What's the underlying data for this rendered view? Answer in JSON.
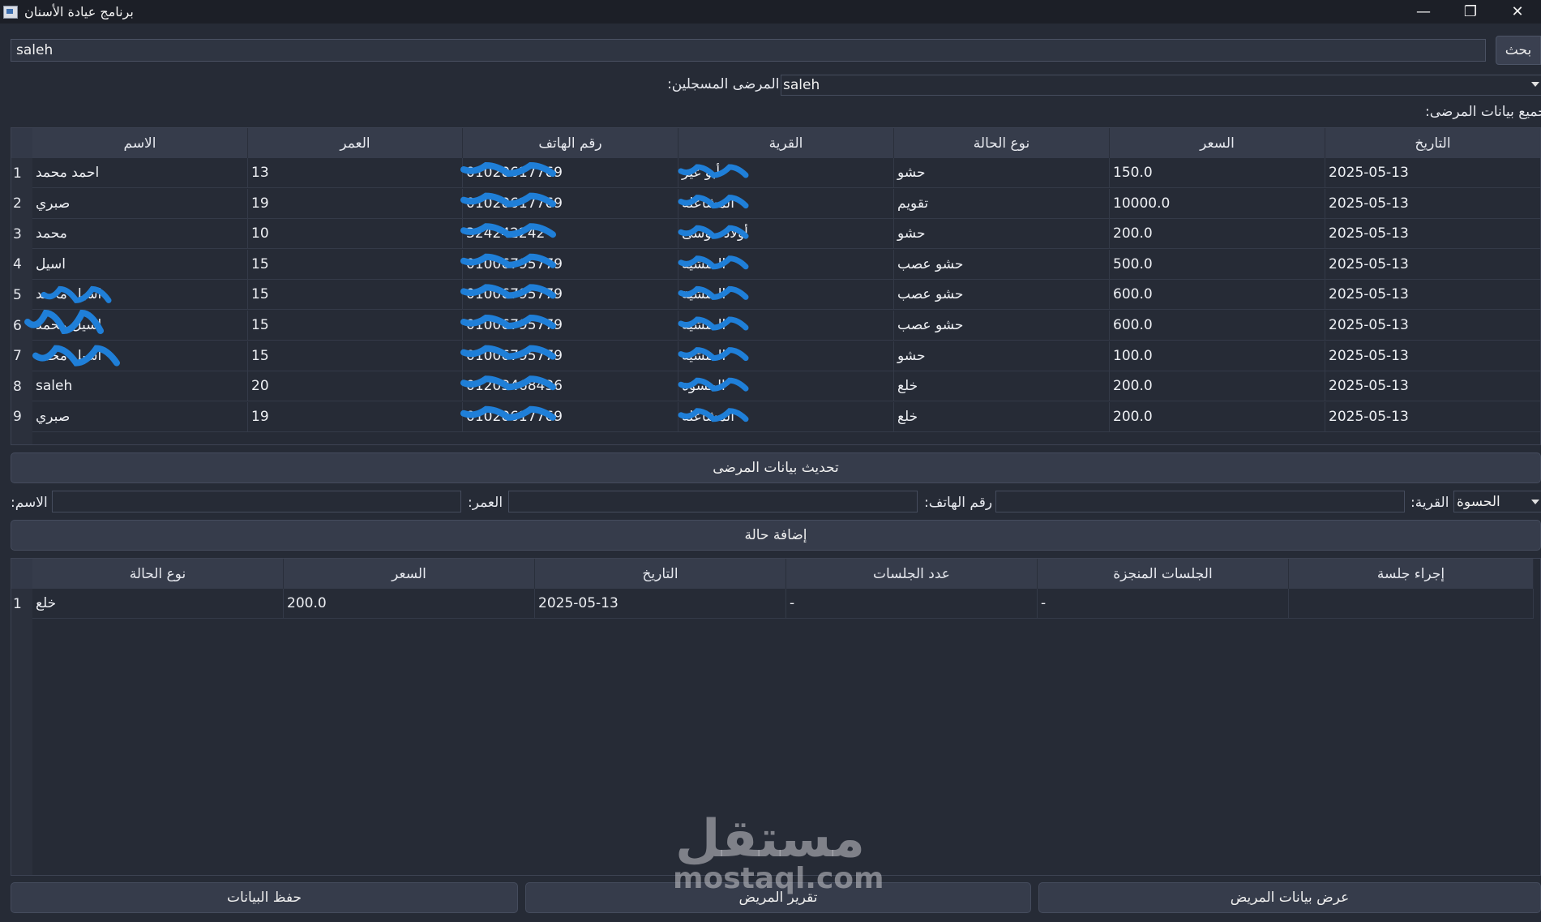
{
  "window": {
    "title": "برنامج عيادة الأسنان",
    "controls": [
      "—",
      "❐",
      "✕"
    ]
  },
  "search": {
    "value": "saleh",
    "button_label": "بحث"
  },
  "registered_patients": {
    "label": "المرضى المسجلين:",
    "selected": "saleh"
  },
  "all_patients_label": "جميع بيانات المرضى:",
  "patients_table": {
    "columns": [
      "الاسم",
      "العمر",
      "رقم الهاتف",
      "القرية",
      "نوع الحالة",
      "السعر",
      "التاريخ"
    ],
    "rows": [
      [
        "احمد محمد",
        "13",
        "01020617769",
        "أبو غير",
        "حشو",
        "150.0",
        "2025-05-13"
      ],
      [
        "صبري",
        "19",
        "01020617769",
        "المشاعلة",
        "تقويم",
        "10000.0",
        "2025-05-13"
      ],
      [
        "محمد",
        "10",
        "324242242",
        "أولاد موسى",
        "حشو",
        "200.0",
        "2025-05-13"
      ],
      [
        "اسيل",
        "15",
        "01006795779",
        "المنشية",
        "حشو عصب",
        "500.0",
        "2025-05-13"
      ],
      [
        "اسيل محمد",
        "15",
        "01006795779",
        "المنشية",
        "حشو عصب",
        "600.0",
        "2025-05-13"
      ],
      [
        "اسيل محمد",
        "15",
        "01006795779",
        "المنشية",
        "حشو عصب",
        "600.0",
        "2025-05-13"
      ],
      [
        "اسيل محمد",
        "15",
        "01006795779",
        "المنشية",
        "حشو",
        "100.0",
        "2025-05-13"
      ],
      [
        "saleh",
        "20",
        "01203468436",
        "الحسوة",
        "خلع",
        "200.0",
        "2025-05-13"
      ],
      [
        "صبري",
        "19",
        "01020617769",
        "المشاعلة",
        "خلع",
        "200.0",
        "2025-05-13"
      ]
    ]
  },
  "update_button_label": "تحديث بيانات المرضى",
  "form": {
    "name_label": "الاسم:",
    "age_label": "العمر:",
    "phone_label": "رقم الهاتف:",
    "village_label": "القرية:",
    "village_selected": "الحسوة"
  },
  "add_case_button_label": "إضافة حالة",
  "cases_table": {
    "columns": [
      "نوع الحالة",
      "السعر",
      "التاريخ",
      "عدد الجلسات",
      "الجلسات المنجزة",
      "إجراء جلسة"
    ],
    "rows": [
      [
        "خلع",
        "200.0",
        "2025-05-13",
        "-",
        "-",
        ""
      ]
    ]
  },
  "bottom_buttons": {
    "save": "حفظ البيانات",
    "report": "تقرير المريض",
    "show": "عرض بيانات المريض"
  },
  "watermark": {
    "arabic": "مستقل",
    "latin": "mostaql.com"
  },
  "colors": {
    "background": "#262b36",
    "titlebar": "#1c1f27",
    "header": "#363c4b",
    "scribble": "#1f7fd8"
  }
}
